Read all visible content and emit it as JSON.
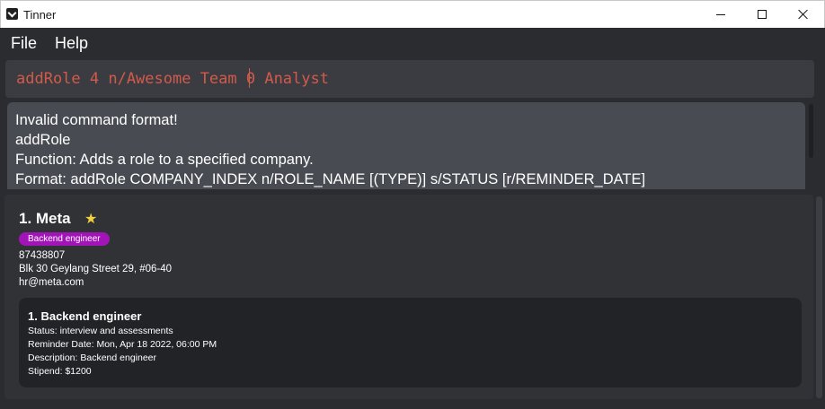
{
  "window": {
    "title": "Tinner"
  },
  "menu": {
    "items": [
      "File",
      "Help"
    ]
  },
  "command": {
    "value": "addRole 4 n/Awesome Team 0 Analyst"
  },
  "result": {
    "lines": [
      "Invalid command format!",
      "addRole",
      "Function: Adds a role to a specified company.",
      "Format: addRole COMPANY_INDEX n/ROLE_NAME [(TYPE)] s/STATUS [r/REMINDER_DATE]"
    ]
  },
  "company": {
    "index_name": "1.  Meta",
    "favourite_icon": "star-icon",
    "tag": "Backend engineer",
    "phone": "87438807",
    "address": "Blk 30 Geylang Street 29, #06-40",
    "email": "hr@meta.com",
    "roles": [
      {
        "title": "1.  Backend engineer",
        "status": "Status: interview and assessments",
        "reminder": "Reminder Date: Mon, Apr 18 2022, 06:00 PM",
        "description": "Description: Backend engineer",
        "stipend": "Stipend: $1200"
      }
    ]
  },
  "colors": {
    "background": "#2a2c30",
    "command_text": "#d35a4a",
    "tag": "#a214b8",
    "star": "#f4d03f"
  }
}
